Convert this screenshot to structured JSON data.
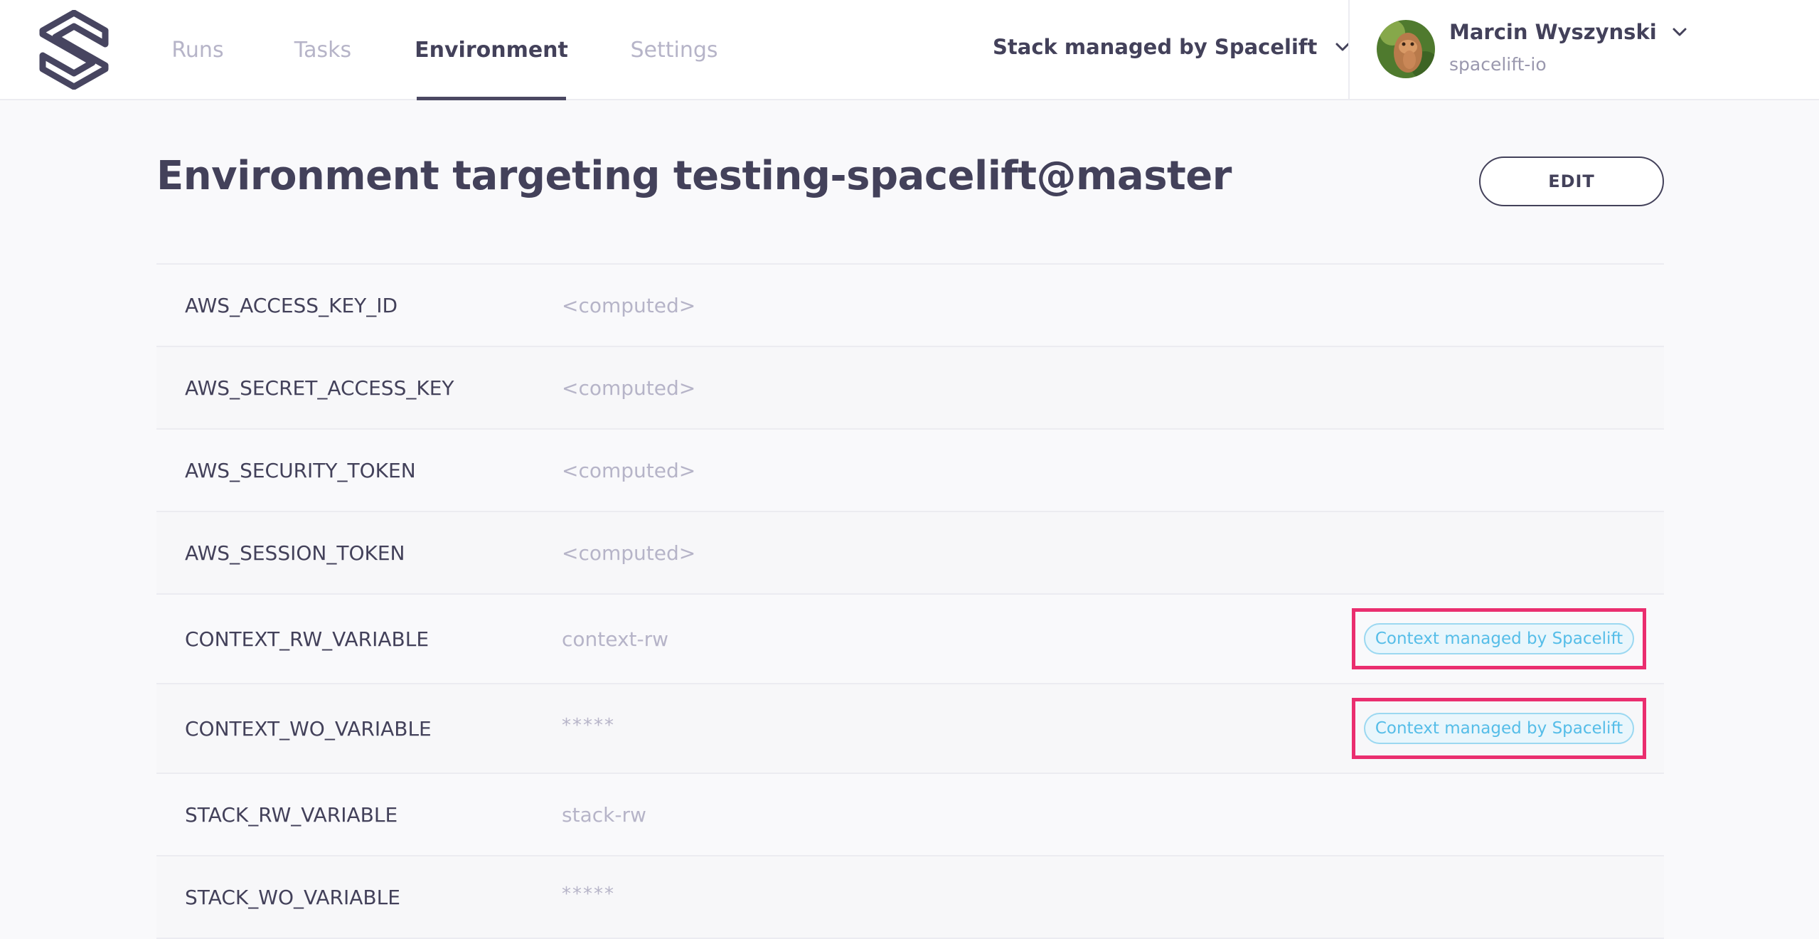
{
  "nav": {
    "tabs": [
      {
        "label": "Runs"
      },
      {
        "label": "Tasks"
      },
      {
        "label": "Environment"
      },
      {
        "label": "Settings"
      }
    ]
  },
  "stack": {
    "label": "Stack managed by Spacelift"
  },
  "user": {
    "name": "Marcin Wyszynski",
    "org": "spacelift-io"
  },
  "main": {
    "title": "Environment targeting testing-spacelift@master",
    "edit_label": "EDIT"
  },
  "env": {
    "rows": [
      {
        "name": "AWS_ACCESS_KEY_ID",
        "value": "<computed>"
      },
      {
        "name": "AWS_SECRET_ACCESS_KEY",
        "value": "<computed>"
      },
      {
        "name": "AWS_SECURITY_TOKEN",
        "value": "<computed>"
      },
      {
        "name": "AWS_SESSION_TOKEN",
        "value": "<computed>"
      },
      {
        "name": "CONTEXT_RW_VARIABLE",
        "value": "context-rw",
        "badge": "Context managed by Spacelift"
      },
      {
        "name": "CONTEXT_WO_VARIABLE",
        "value": "*****",
        "badge": "Context managed by Spacelift"
      },
      {
        "name": "STACK_RW_VARIABLE",
        "value": "stack-rw"
      },
      {
        "name": "STACK_WO_VARIABLE",
        "value": "*****"
      }
    ]
  },
  "colors": {
    "text": "#43415a",
    "muted": "#b6b4c8",
    "badge_text": "#55bde8",
    "badge_border": "#9bd8f1",
    "highlight": "#ea2e6f"
  },
  "icons": {
    "logo": "spacelift-logo",
    "stack_chevron": "chevron-down-icon",
    "user_chevron": "chevron-down-icon"
  }
}
